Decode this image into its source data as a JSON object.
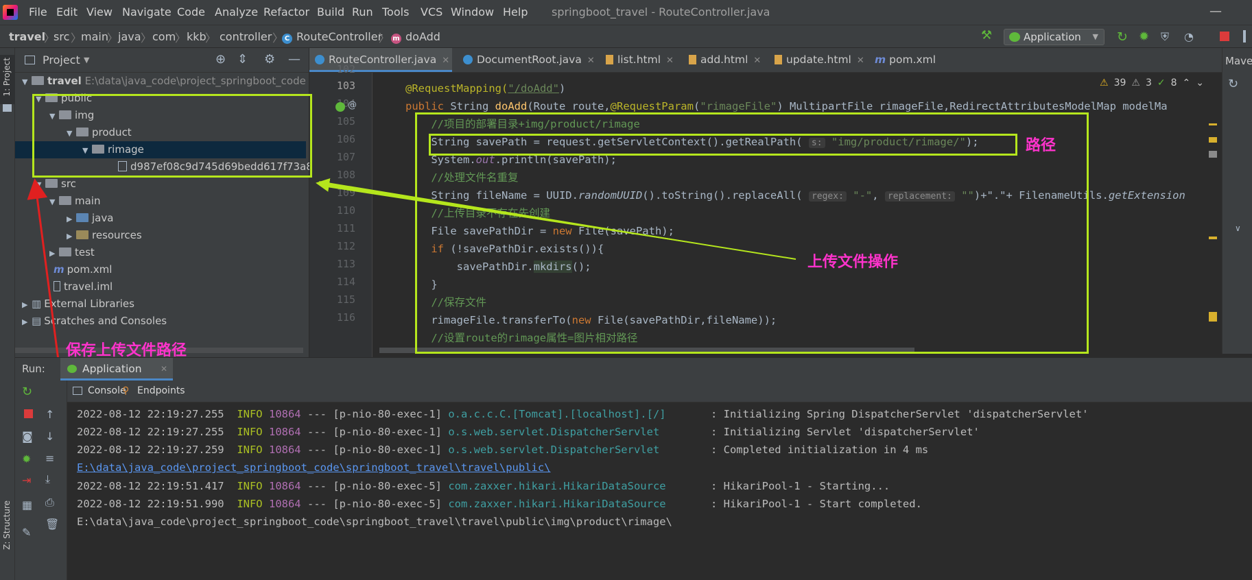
{
  "window_title": "springboot_travel - RouteController.java",
  "menu": [
    "File",
    "Edit",
    "View",
    "Navigate",
    "Code",
    "Analyze",
    "Refactor",
    "Build",
    "Run",
    "Tools",
    "VCS",
    "Window",
    "Help"
  ],
  "breadcrumb": [
    "travel",
    "src",
    "main",
    "java",
    "com",
    "kkb",
    "controller",
    "RouteController",
    "doAdd"
  ],
  "run_config": "Application",
  "project_panel": {
    "title": "Project",
    "side_label": "1: Project",
    "structure_label": "Z: Structure",
    "tree": [
      {
        "label": "travel",
        "suffix": "E:\\data\\java_code\\project_springboot_code",
        "bold": true
      },
      {
        "label": "public"
      },
      {
        "label": "img"
      },
      {
        "label": "product"
      },
      {
        "label": "rimage"
      },
      {
        "label": "d987ef08c9d745d69bedd617f73a8"
      },
      {
        "label": "src"
      },
      {
        "label": "main"
      },
      {
        "label": "java"
      },
      {
        "label": "resources"
      },
      {
        "label": "test"
      },
      {
        "label": "pom.xml"
      },
      {
        "label": "travel.iml"
      },
      {
        "label": "External Libraries"
      },
      {
        "label": "Scratches and Consoles"
      }
    ]
  },
  "editor_tabs": [
    {
      "label": "RouteController.java",
      "active": true
    },
    {
      "label": "DocumentRoot.java"
    },
    {
      "label": "list.html"
    },
    {
      "label": "add.html"
    },
    {
      "label": "update.html"
    },
    {
      "label": "pom.xml (travel)"
    }
  ],
  "maven_label": "Mave",
  "inspections": {
    "warnings": "39",
    "weak": "3",
    "ok": "8"
  },
  "line_numbers": [
    "102",
    "103",
    "104",
    "105",
    "106",
    "107",
    "108",
    "109",
    "110",
    "111",
    "112",
    "113",
    "114",
    "115",
    "116"
  ],
  "code": {
    "l101": "    *",
    "l102_ann": "@RequestMapping(",
    "l102_str": "\"/doAdd\"",
    "l102_end": ")",
    "l103": "public String doAdd(Route route,@RequestParam(\"rimageFile\") MultipartFile rimageFile,RedirectAttributesModelMap modelMa",
    "l104": "    //项目的部署目录+img/product/rimage",
    "l105_a": "    String savePath = request.getServletContext().getRealPath(",
    "l105_hint": "s:",
    "l105_str": "\"img/product/rimage/\"",
    "l105_end": ");",
    "l106_a": "    System.",
    "l106_out": "out",
    "l106_b": ".println(savePath);",
    "l107": "    //处理文件名重复",
    "l108_a": "    String fileName = UUID.",
    "l108_uuid": "randomUUID",
    "l108_b": "().toString().replaceAll(",
    "l108_hint1": "regex:",
    "l108_str1": "\"-\"",
    "l108_c": ", ",
    "l108_hint2": "replacement:",
    "l108_str2": "\"\"",
    "l108_d": ")+\".\"+ FilenameUtils.",
    "l108_ext": "getExtension",
    "l109": "    //上传目录不存在先创建",
    "l110_a": "    File savePathDir = ",
    "l110_kw": "new",
    "l110_b": " File(savePath);",
    "l111_kw": "    if",
    "l111_b": " (!savePathDir.exists()){",
    "l112_a": "        savePathDir.",
    "l112_m": "mkdirs",
    "l112_b": "();",
    "l113": "    }",
    "l114": "    //保存文件",
    "l115_a": "    rimageFile.transferTo(",
    "l115_kw": "new",
    "l115_b": " File(savePathDir,fileName));",
    "l116": "    //设置route的rimage属性=图片相对路径"
  },
  "annotations": {
    "path_label": "路径",
    "upload_label": "上传文件操作",
    "save_label": "保存上传文件路径"
  },
  "run_panel": {
    "label": "Run:",
    "app_tab": "Application",
    "console_tab": "Console",
    "endpoints_tab": "Endpoints"
  },
  "console": [
    {
      "ts": "2022-08-12 22:19:27.255",
      "level": "INFO",
      "pid": "10864",
      "sep": "---",
      "thread": "[p-nio-80-exec-1]",
      "logger": "o.a.c.c.C.[Tomcat].[localhost].[/]      ",
      "msg": ": Initializing Spring DispatcherServlet 'dispatcherServlet'"
    },
    {
      "ts": "2022-08-12 22:19:27.255",
      "level": "INFO",
      "pid": "10864",
      "sep": "---",
      "thread": "[p-nio-80-exec-1]",
      "logger": "o.s.web.servlet.DispatcherServlet       ",
      "msg": ": Initializing Servlet 'dispatcherServlet'"
    },
    {
      "ts": "2022-08-12 22:19:27.259",
      "level": "INFO",
      "pid": "10864",
      "sep": "---",
      "thread": "[p-nio-80-exec-1]",
      "logger": "o.s.web.servlet.DispatcherServlet       ",
      "msg": ": Completed initialization in 4 ms"
    },
    {
      "path": "E:\\data\\java_code\\project_springboot_code\\springboot_travel\\travel\\public\\"
    },
    {
      "ts": "2022-08-12 22:19:51.417",
      "level": "INFO",
      "pid": "10864",
      "sep": "---",
      "thread": "[p-nio-80-exec-5]",
      "logger": "com.zaxxer.hikari.HikariDataSource      ",
      "msg": ": HikariPool-1 - Starting..."
    },
    {
      "ts": "2022-08-12 22:19:51.990",
      "level": "INFO",
      "pid": "10864",
      "sep": "---",
      "thread": "[p-nio-80-exec-5]",
      "logger": "com.zaxxer.hikari.HikariDataSource      ",
      "msg": ": HikariPool-1 - Start completed."
    },
    {
      "plain": "E:\\data\\java_code\\project_springboot_code\\springboot_travel\\travel\\public\\img\\product\\rimage\\"
    }
  ],
  "colors": {
    "accent": "#4a88c7",
    "highlight_box": "#b5e61d",
    "red_box": "#e02020",
    "note": "#ff33cc"
  }
}
